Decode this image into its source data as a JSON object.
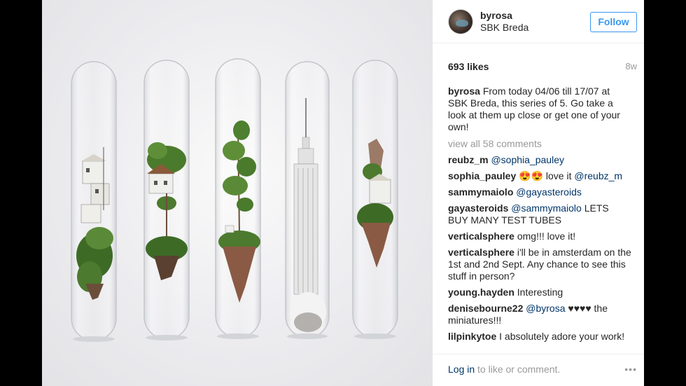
{
  "post": {
    "username": "byrosa",
    "location": "SBK Breda",
    "follow_label": "Follow",
    "likes": "693 likes",
    "age": "8w",
    "caption_user": "byrosa",
    "caption_text": "From today 04/06 till 17/07 at SBK Breda, this series of 5. Go take a look at them up close or get one of your own!",
    "view_all": "view all 58 comments"
  },
  "comments": [
    {
      "user": "reubz_m",
      "mention": "@sophia_pauley",
      "text": ""
    },
    {
      "user": "sophia_pauley",
      "text_before": "😍😍 love it",
      "mention": "@reubz_m"
    },
    {
      "user": "sammymaiolo",
      "mention": "@gayasteroids",
      "text": ""
    },
    {
      "user": "gayasteroids",
      "mention": "@sammymaiolo",
      "text": "LETS BUY MANY TEST TUBES"
    },
    {
      "user": "verticalsphere",
      "text": "omg!!! love it!"
    },
    {
      "user": "verticalsphere",
      "text": "i'll be in amsterdam on the 1st and 2nd Sept. Any chance to see this stuff in person?"
    },
    {
      "user": "young.hayden",
      "text": "Interesting"
    },
    {
      "user": "denisebourne22",
      "mention": "@byrosa",
      "text": "♥♥♥♥ the miniatures!!!"
    },
    {
      "user": "lilpinkytoe",
      "text": "I absolutely adore your work!"
    }
  ],
  "footer": {
    "login_link": "Log in",
    "login_text": "to like or comment.",
    "more_icon": "•••"
  },
  "icons": {
    "avatar": "profile-avatar",
    "more": "more-options-icon"
  },
  "colors": {
    "accent": "#3897f0",
    "link": "#003569",
    "muted": "#999999",
    "text": "#262626"
  }
}
